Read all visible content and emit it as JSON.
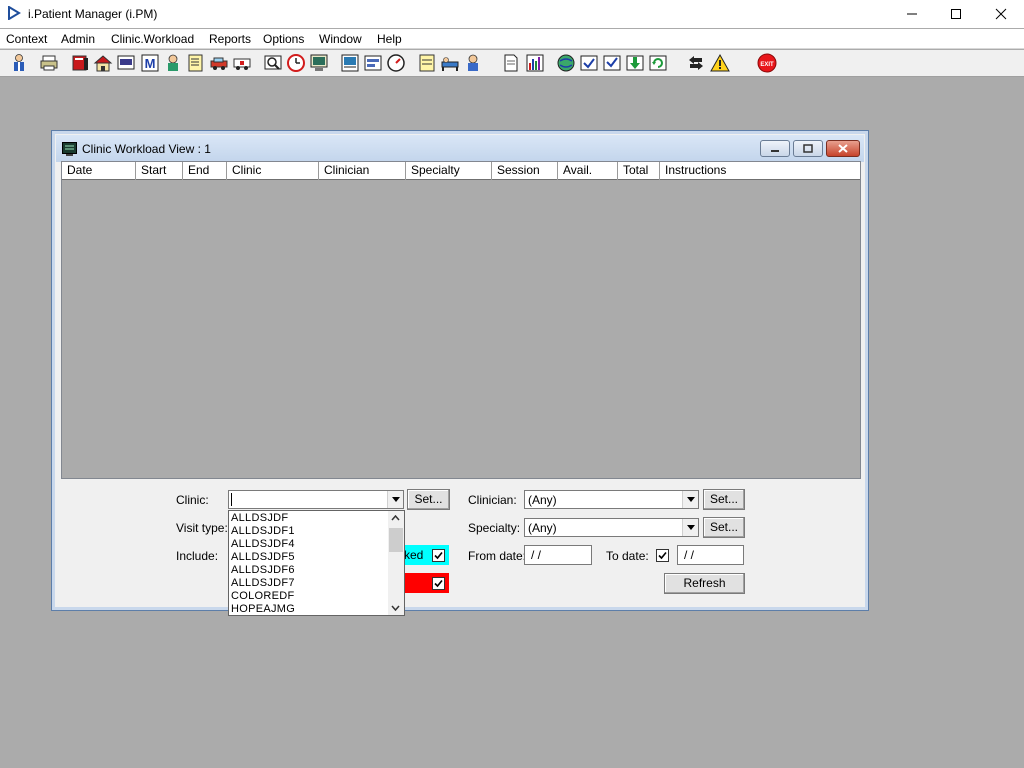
{
  "window": {
    "title": "i.Patient Manager (i.PM)"
  },
  "menu": [
    "Context",
    "Admin",
    "Clinic.Workload",
    "Reports",
    "Options",
    "Window",
    "Help"
  ],
  "toolbar_icons": [
    "patient-icon",
    "printer-icon",
    "book-icon",
    "house-icon",
    "card-icon",
    "m-icon",
    "doctor-icon",
    "notes-icon",
    "car-icon",
    "ambulance-icon",
    "scan-icon",
    "clock-icon",
    "monitor-icon",
    "chart-icon",
    "form-icon",
    "gauge-icon",
    "note-icon",
    "bed-icon",
    "nurse-icon",
    "document-icon",
    "bar-chart-icon",
    "globe-icon",
    "check-icon",
    "check-down-icon",
    "arrow-down-icon",
    "refresh-icon",
    "swap-icon",
    "warning-icon",
    "exit-icon"
  ],
  "child": {
    "title": "Clinic Workload View : 1",
    "columns": [
      "Date",
      "Start",
      "End",
      "Clinic",
      "Clinician",
      "Specialty",
      "Session",
      "Avail.",
      "Total",
      "Instructions"
    ]
  },
  "filters": {
    "clinic_label": "Clinic:",
    "clinic_value": "",
    "visit_type_label": "Visit type:",
    "include_label": "Include:",
    "booked_fragment": "ked",
    "set_label": "Set...",
    "clinician_label": "Clinician:",
    "clinician_value": "(Any)",
    "specialty_label": "Specialty:",
    "specialty_value": "(Any)",
    "from_date_label": "From date:",
    "from_date_value": "/ /",
    "to_date_label": "To date:",
    "to_date_value": "/ /",
    "refresh_label": "Refresh"
  },
  "dropdown_items": [
    "ALLDSJDF",
    "ALLDSJDF1",
    "ALLDSJDF4",
    "ALLDSJDF5",
    "ALLDSJDF6",
    "ALLDSJDF7",
    "COLOREDF",
    "HOPEAJMG"
  ],
  "colors": {
    "booked_highlight": "#00ffff",
    "unbooked_highlight": "#ff0000",
    "exit": "#e8161b"
  }
}
